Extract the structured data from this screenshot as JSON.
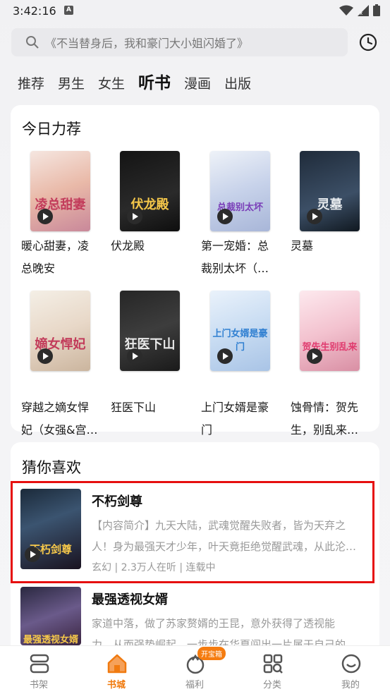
{
  "status": {
    "time": "3:42:16",
    "a_badge": "A"
  },
  "search": {
    "placeholder": "《不当替身后，我和豪门大小姐闪婚了》"
  },
  "tabs": [
    {
      "label": "推荐"
    },
    {
      "label": "男生"
    },
    {
      "label": "女生"
    },
    {
      "label": "听书"
    },
    {
      "label": "漫画"
    },
    {
      "label": "出版"
    }
  ],
  "active_tab": "听书",
  "recommend": {
    "title": "今日力荐",
    "books": [
      {
        "line1": "暖心甜妻，凌",
        "line2": "总晚安",
        "cover_text": "凌总甜妻"
      },
      {
        "line1": "伏龙殿",
        "line2": "",
        "cover_text": "伏龙殿"
      },
      {
        "line1": "第一宠婚：总",
        "line2": "裁别太坏（…",
        "cover_text": "总裁别太坏"
      },
      {
        "line1": "灵墓",
        "line2": "",
        "cover_text": "灵墓"
      },
      {
        "line1": "穿越之嫡女悍",
        "line2": "妃（女强&宫…",
        "cover_text": "嫡女悍妃"
      },
      {
        "line1": "狂医下山",
        "line2": "",
        "cover_text": "狂医下山"
      },
      {
        "line1": "上门女婿是豪",
        "line2": "门",
        "cover_text": "上门女婿是豪门"
      },
      {
        "line1": "蚀骨情：贺先",
        "line2": "生，别乱来…",
        "cover_text": "贺先生别乱来"
      }
    ]
  },
  "guess": {
    "title": "猜你喜欢",
    "items": [
      {
        "title": "不朽剑尊",
        "desc1": "【内容简介】九天大陆，武魂觉醒失败者，皆为天弃之",
        "desc2": "人！身为最强天才少年，叶天竟拒绝觉醒武魂，从此沦…",
        "meta": "玄幻 | 2.3万人在听 | 连载中",
        "cover_text": "不朽剑尊"
      },
      {
        "title": "最强透视女婿",
        "desc1": "家道中落，做了苏家赘婿的王昆，意外获得了透视能",
        "desc2": "力，从而强势崛起，一步步在华夏闯出一片属于自己的…",
        "cover_text": "最强透视女婿"
      }
    ]
  },
  "nav": {
    "items": [
      {
        "label": "书架"
      },
      {
        "label": "书城"
      },
      {
        "label": "福利"
      },
      {
        "label": "分类"
      },
      {
        "label": "我的"
      }
    ],
    "badge": "开宝箱"
  }
}
